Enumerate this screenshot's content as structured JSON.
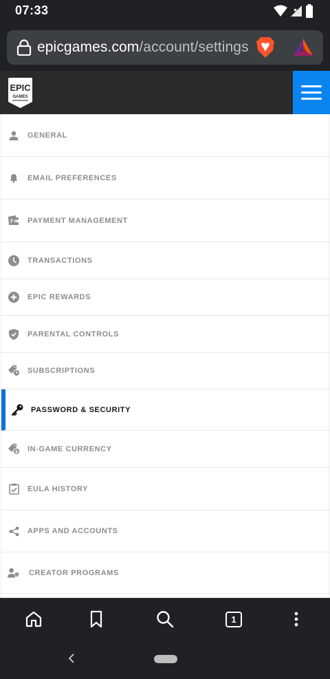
{
  "status_bar": {
    "time": "07:33"
  },
  "browser": {
    "url_domain": "epicgames.com",
    "url_path": "/account/settings",
    "tab_count": "1"
  },
  "site": {
    "logo_line1": "EPIC",
    "logo_line2": "GAMES"
  },
  "menu": {
    "items": [
      {
        "label": "GENERAL",
        "icon": "person-icon"
      },
      {
        "label": "EMAIL PREFERENCES",
        "icon": "bell-icon"
      },
      {
        "label": "PAYMENT MANAGEMENT",
        "icon": "wallet-icon"
      },
      {
        "label": "TRANSACTIONS",
        "icon": "clock-icon"
      },
      {
        "label": "EPIC REWARDS",
        "icon": "plus-circle-icon"
      },
      {
        "label": "PARENTAL CONTROLS",
        "icon": "shield-icon"
      },
      {
        "label": "SUBSCRIPTIONS",
        "icon": "tag-clock-icon"
      },
      {
        "label": "PASSWORD & SECURITY",
        "icon": "key-icon",
        "active": true
      },
      {
        "label": "IN-GAME CURRENCY",
        "icon": "coin-tag-icon"
      },
      {
        "label": "EULA HISTORY",
        "icon": "clipboard-check-icon"
      },
      {
        "label": "APPS AND ACCOUNTS",
        "icon": "share-icon"
      },
      {
        "label": "CREATOR PROGRAMS",
        "icon": "creator-icon"
      }
    ]
  },
  "colors": {
    "accent_blue": "#0a84f1",
    "active_border": "#0a74d9",
    "header_bg": "#2a2a2a",
    "browser_chrome": "#202124"
  }
}
